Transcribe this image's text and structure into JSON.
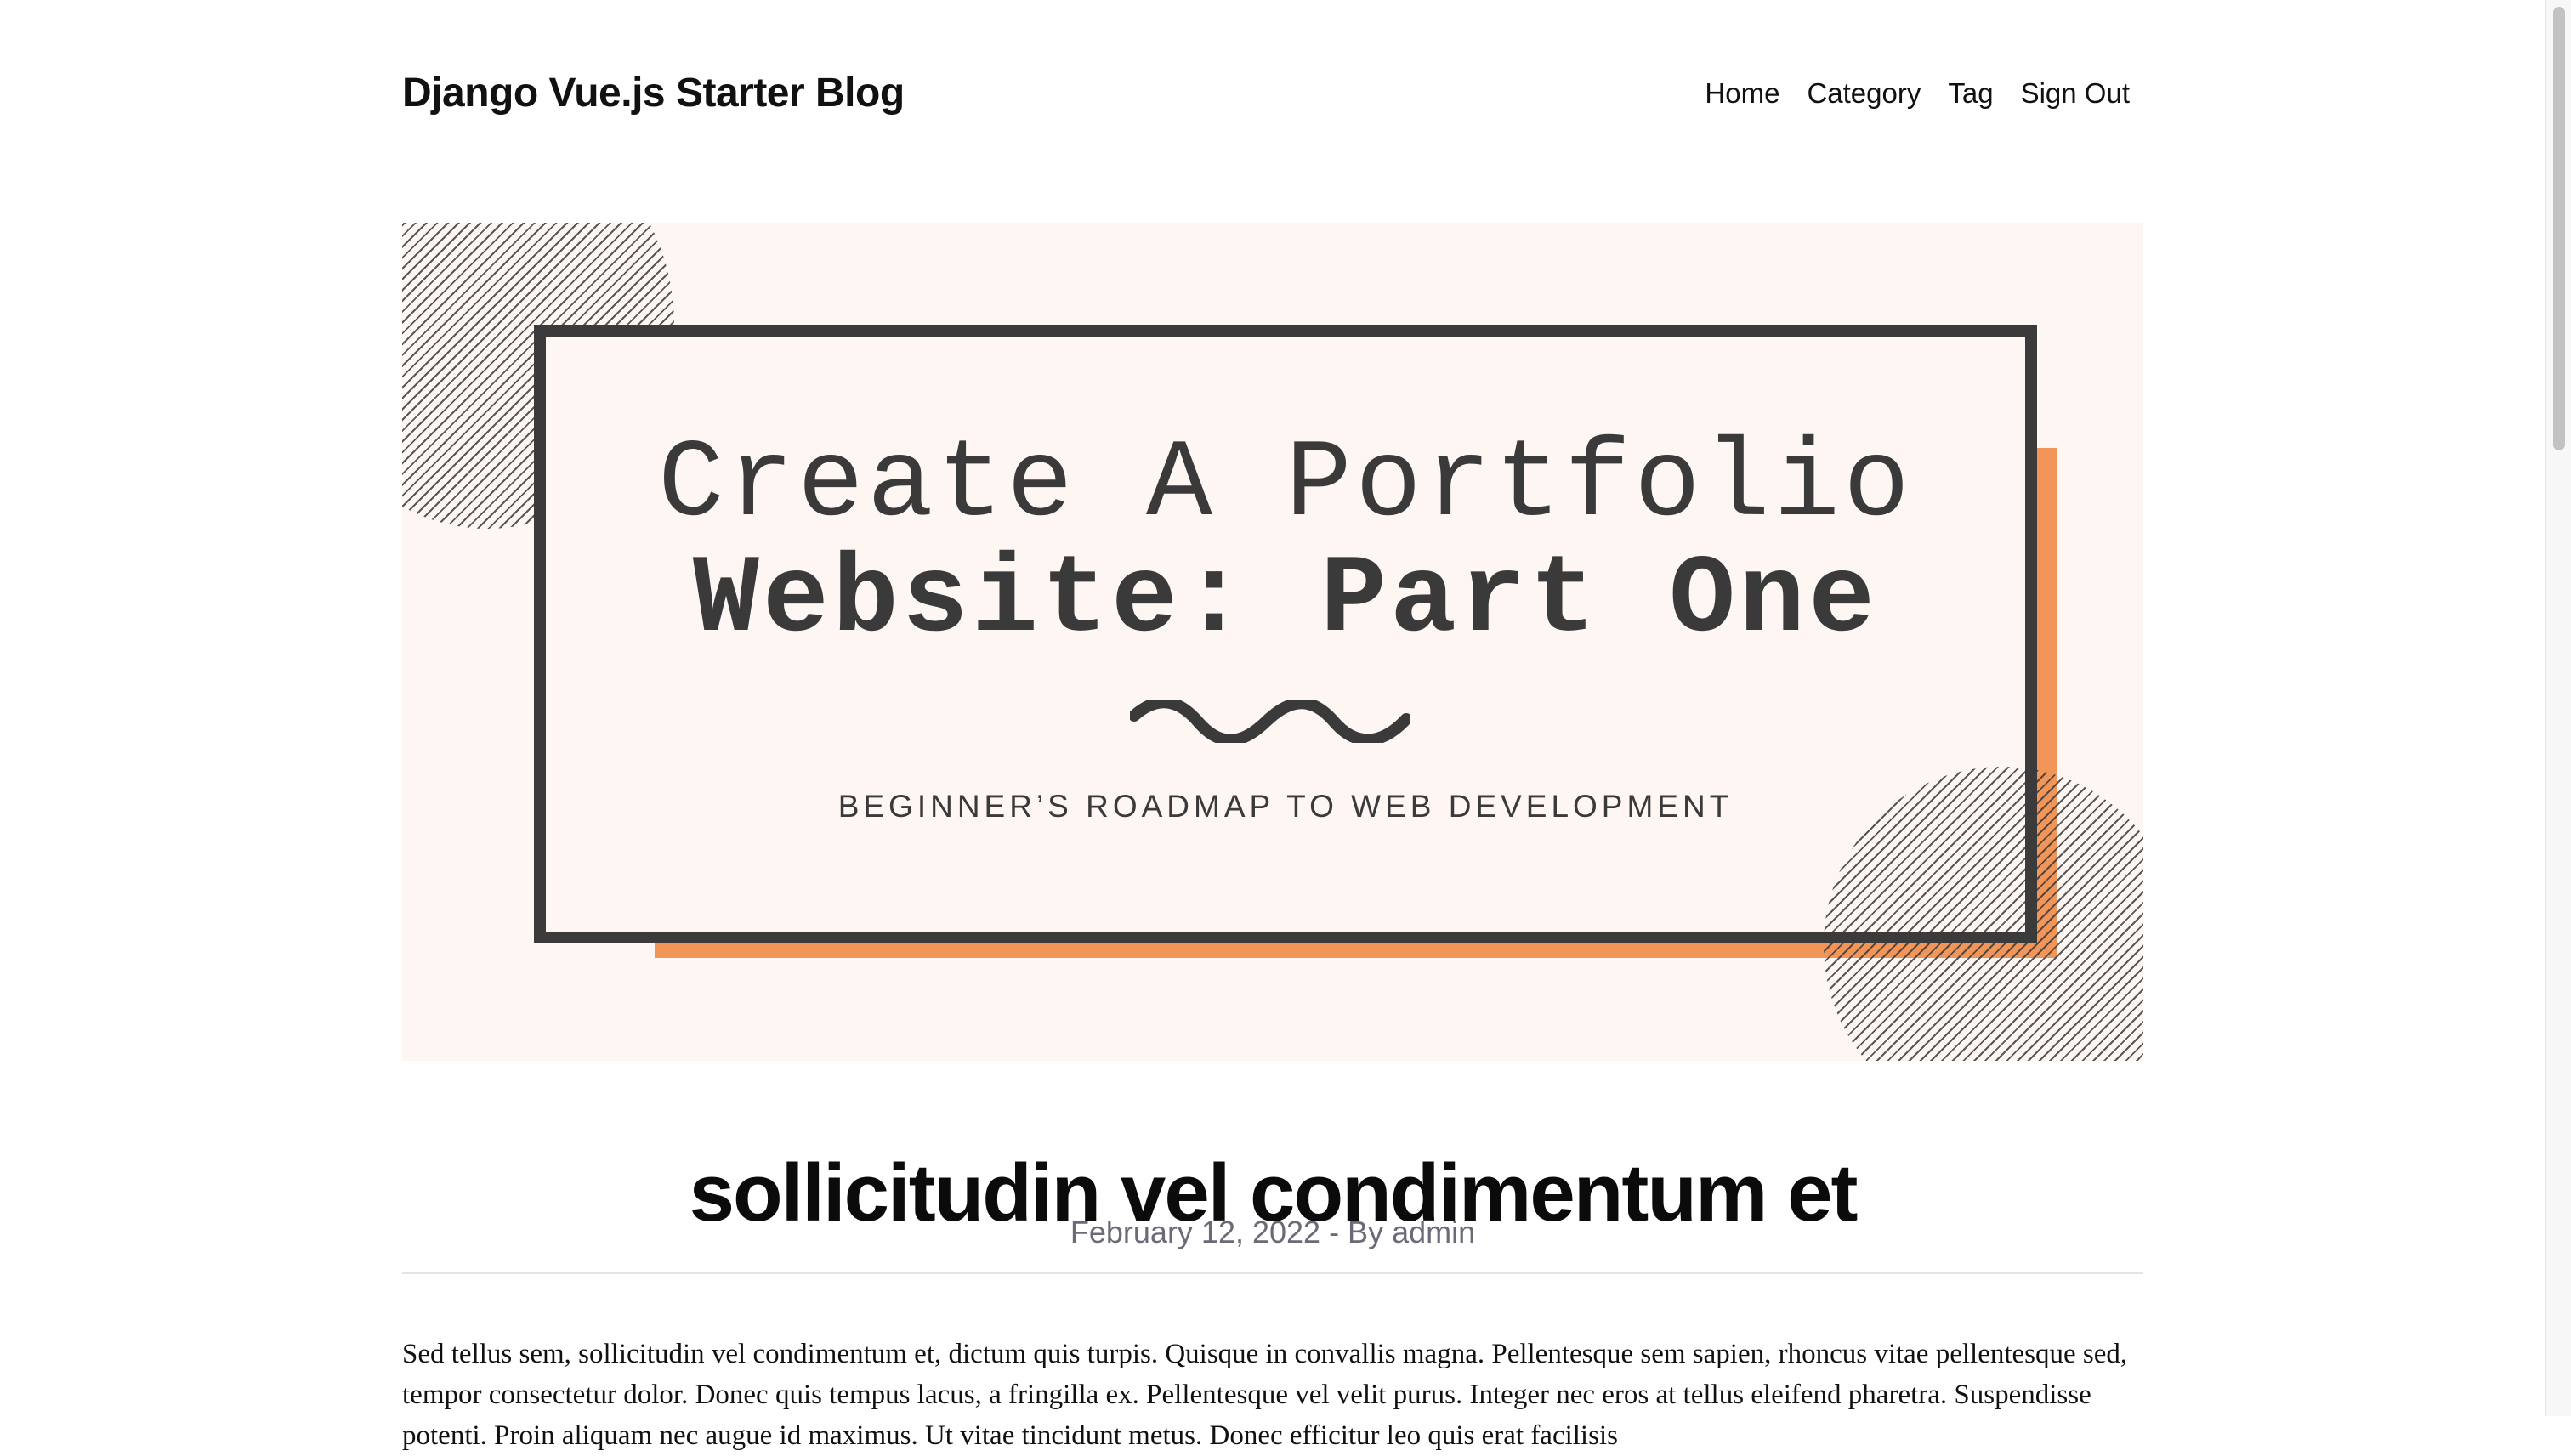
{
  "header": {
    "brand": "Django Vue.js Starter Blog",
    "nav": {
      "home": "Home",
      "category": "Category",
      "tag": "Tag",
      "sign_out": "Sign Out"
    }
  },
  "hero": {
    "title_line1": "Create A Portfolio",
    "title_line2": "Website: Part One",
    "subtitle": "BEGINNER’S ROADMAP TO WEB DEVELOPMENT",
    "colors": {
      "background": "#fdf6f3",
      "frame": "#3b3b3b",
      "accent": "#f29559"
    }
  },
  "post": {
    "title": "sollicitudin vel condimentum et",
    "meta": "February 12, 2022 - By admin",
    "body": "Sed tellus sem, sollicitudin vel condimentum et, dictum quis turpis. Quisque in convallis magna. Pellentesque sem sapien, rhoncus vitae pellentesque sed, tempor consectetur dolor. Donec quis tempus lacus, a fringilla ex. Pellentesque vel velit purus. Integer nec eros at tellus eleifend pharetra. Suspendisse potenti. Proin aliquam nec augue id maximus. Ut vitae tincidunt metus. Donec efficitur leo quis erat facilisis"
  }
}
